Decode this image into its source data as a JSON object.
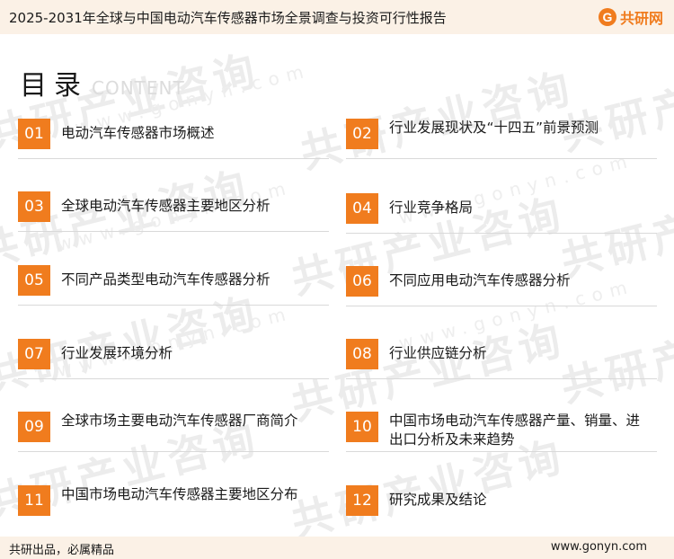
{
  "header": {
    "title": "2025-2031年全球与中国电动汽车传感器市场全景调查与投资可行性报告",
    "logo_mark": "G",
    "logo_text": "共研网"
  },
  "watermark": {
    "text": "共研产业咨询",
    "url": "www.gonyn.com"
  },
  "toc": {
    "title": "目录",
    "subtitle": "CONTENT",
    "items": [
      {
        "num": "01",
        "label": "电动汽车传感器市场概述"
      },
      {
        "num": "02",
        "label": "行业发展现状及“十四五”前景预测"
      },
      {
        "num": "03",
        "label": "全球电动汽车传感器主要地区分析"
      },
      {
        "num": "04",
        "label": "行业竞争格局"
      },
      {
        "num": "05",
        "label": "不同产品类型电动汽车传感器分析"
      },
      {
        "num": "06",
        "label": "不同应用电动汽车传感器分析"
      },
      {
        "num": "07",
        "label": "行业发展环境分析"
      },
      {
        "num": "08",
        "label": "行业供应链分析"
      },
      {
        "num": "09",
        "label": "全球市场主要电动汽车传感器厂商简介"
      },
      {
        "num": "10",
        "label": "中国市场电动汽车传感器产量、销量、进出口分析及未来趋势"
      },
      {
        "num": "11",
        "label": "中国市场电动汽车传感器主要地区分布"
      },
      {
        "num": "12",
        "label": "研究成果及结论"
      }
    ]
  },
  "footer": {
    "left": "共研出品，必属精品",
    "right": "www.gonyn.com"
  },
  "colors": {
    "accent": "#f07c1e",
    "header_bg": "#fbf1e6"
  }
}
